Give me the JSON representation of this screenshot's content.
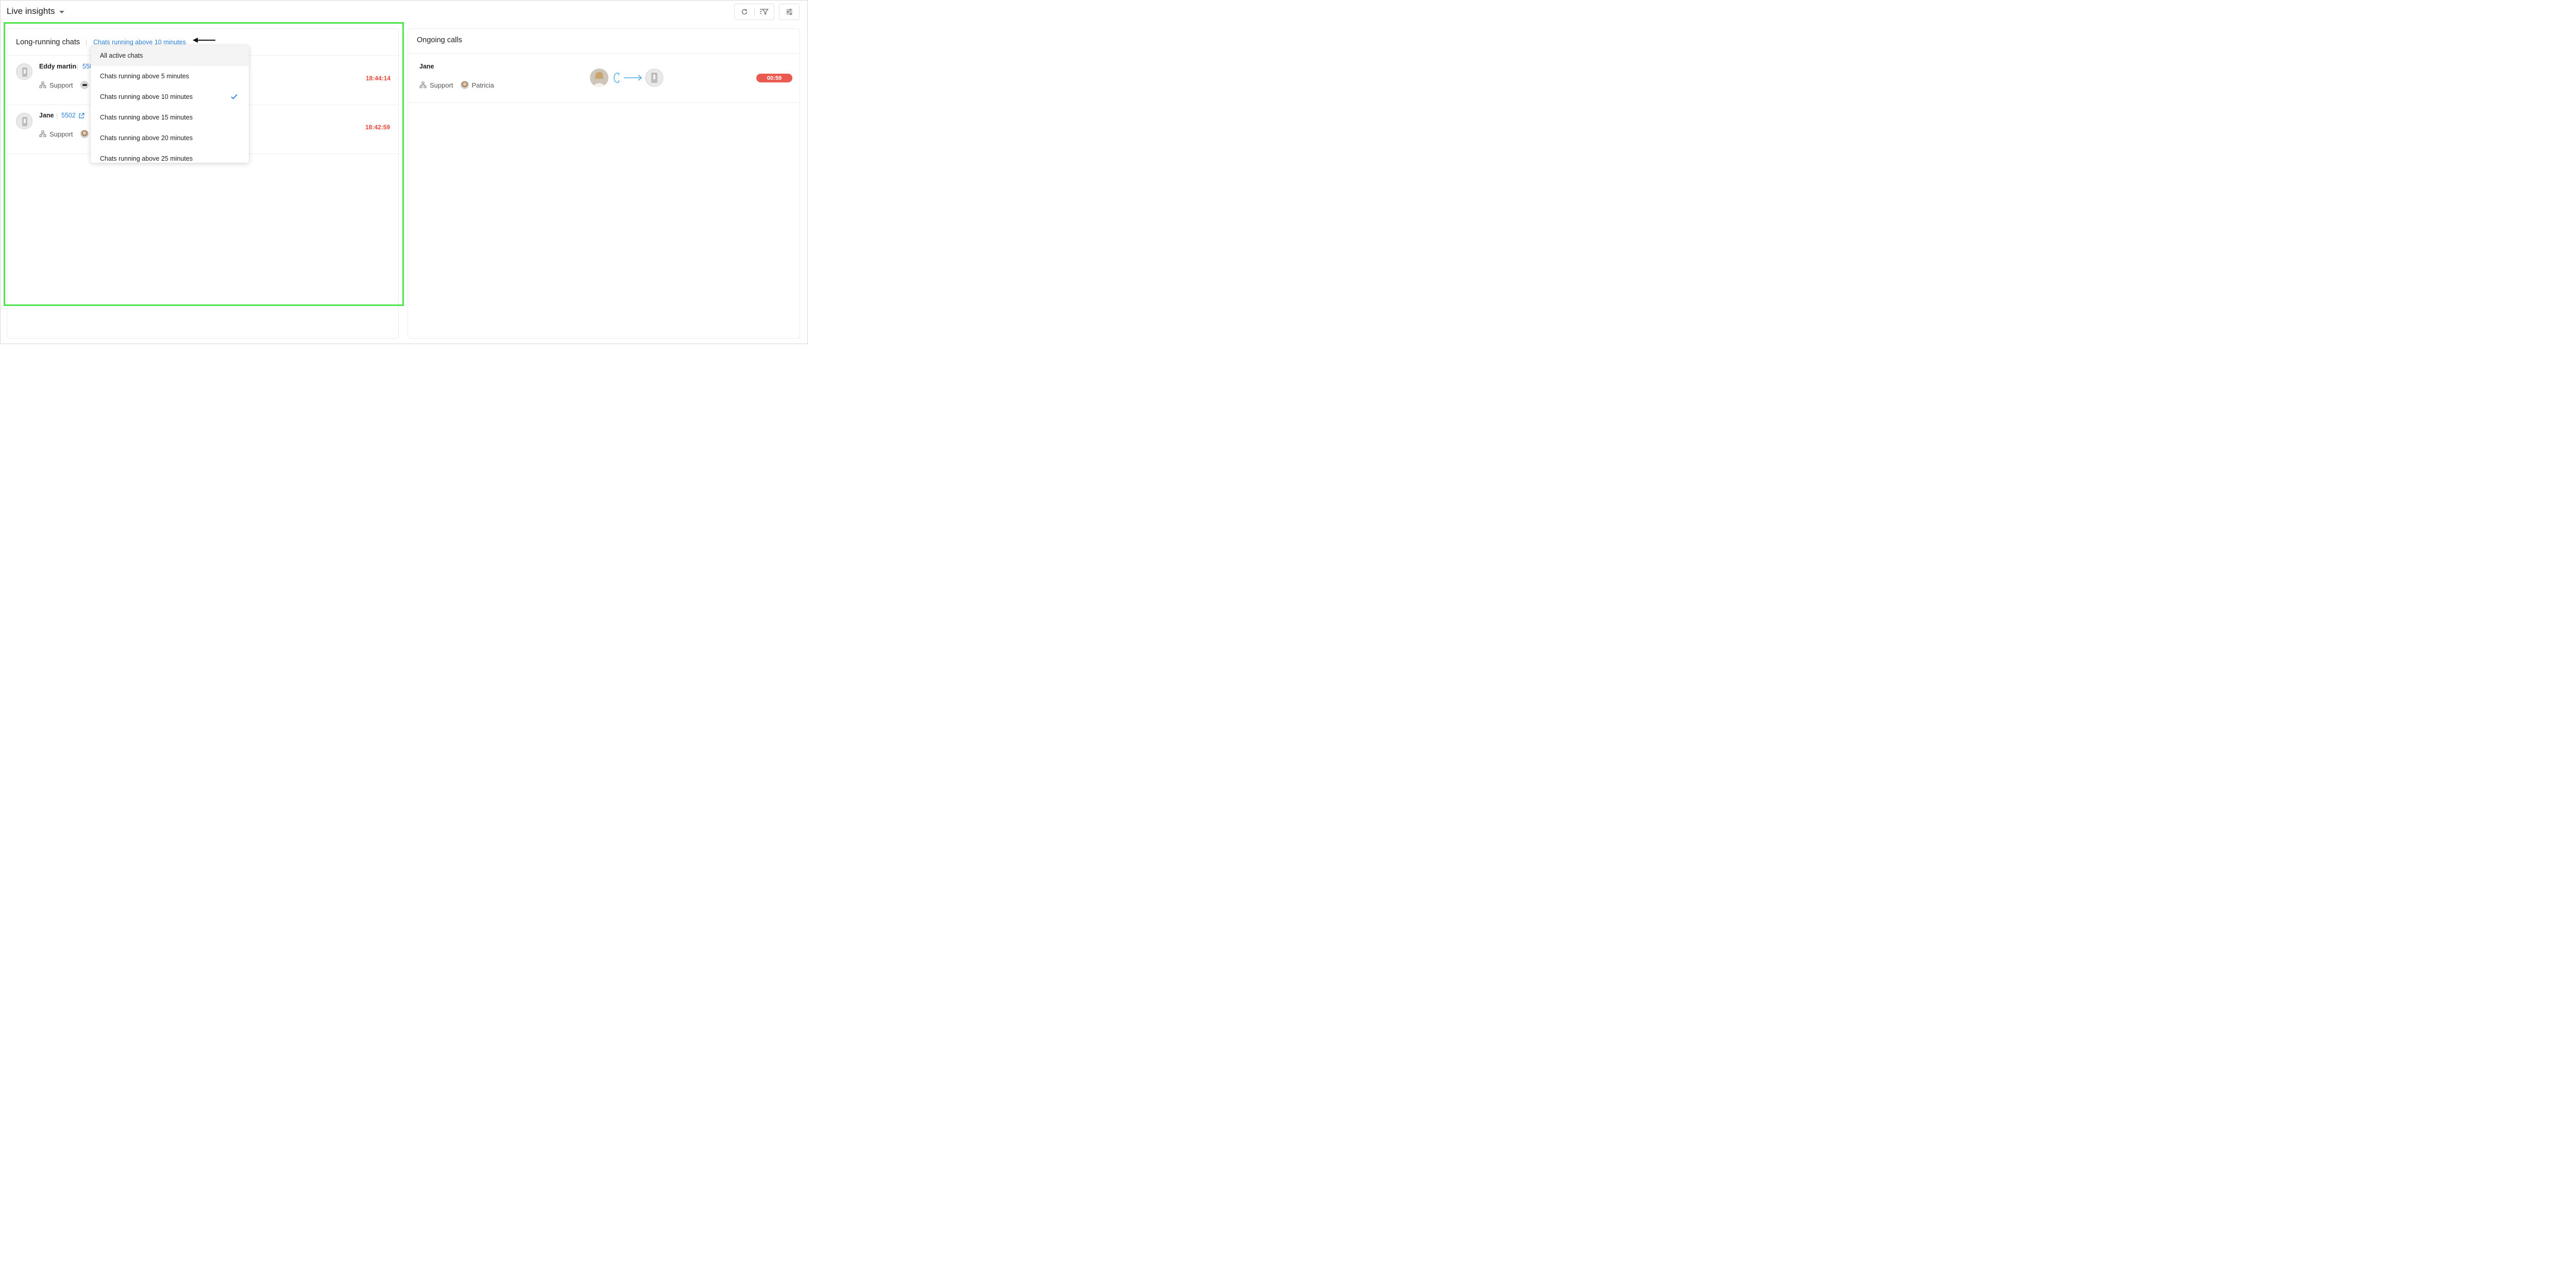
{
  "header": {
    "title": "Live insights",
    "icons": [
      "refresh-icon",
      "filter-icon",
      "settings-sliders-icon"
    ]
  },
  "left_panel": {
    "title": "Long-running chats",
    "filter_label": "Chats running above 10 minutes",
    "rows": [
      {
        "name": "Eddy martin",
        "id": "550",
        "department": "Support",
        "time": "18:44:14"
      },
      {
        "name": "Jane",
        "id": "5502",
        "department": "Support",
        "time": "18:42:59"
      }
    ],
    "dropdown": {
      "options": [
        "All active chats",
        "Chats running above 5 minutes",
        "Chats running above 10 minutes",
        "Chats running above 15 minutes",
        "Chats running above 20 minutes",
        "Chats running above 25 minutes"
      ],
      "hovered": "All active chats",
      "selected": "Chats running above 10 minutes"
    }
  },
  "right_panel": {
    "title": "Ongoing calls",
    "calls": [
      {
        "name": "Jane",
        "department": "Support",
        "agent": "Patricia",
        "duration": "00:59"
      }
    ]
  },
  "colors": {
    "accent_blue": "#2b7fd6",
    "time_red": "#e5483a",
    "duration_pill": "#ea5a4f",
    "highlight_green": "#4ee44e",
    "call_arrow": "#4aa8e8"
  }
}
